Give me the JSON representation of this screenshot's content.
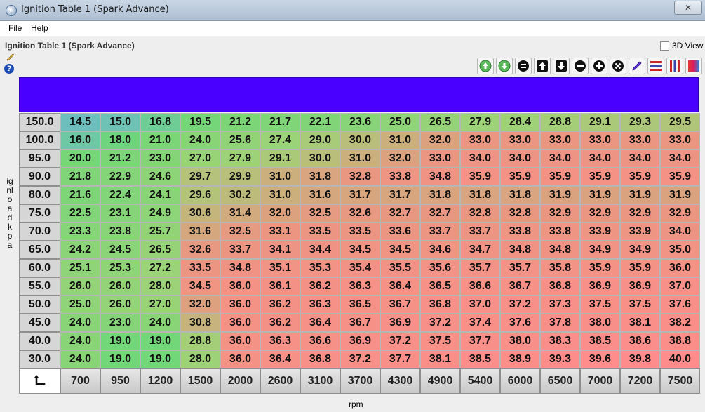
{
  "window": {
    "title": "Ignition Table 1 (Spark Advance)",
    "close": "✕"
  },
  "menu": {
    "file": "File",
    "help": "Help"
  },
  "panel": {
    "title": "Ignition Table 1 (Spark Advance)",
    "view3d_label": "3D View",
    "help_glyph": "?"
  },
  "toolbar": {
    "icons": [
      "increment-green-icon",
      "decrement-green-icon",
      "equal-icon",
      "arrow-up-icon",
      "arrow-down-icon",
      "minus-icon",
      "plus-icon",
      "multiply-icon",
      "pencil-icon",
      "horizontal-interpolate-icon",
      "vertical-interpolate-icon",
      "color-gradient-icon"
    ]
  },
  "colors": {
    "banner": "#4a00ff",
    "cool": "#5fd06e",
    "hot": "#ff9a8c"
  },
  "table": {
    "y_axis_title": "ignload kpa",
    "x_axis_title": "rpm",
    "corner_icon": "swap-axes-icon",
    "rpm": [
      "700",
      "950",
      "1200",
      "1500",
      "2000",
      "2600",
      "3100",
      "3700",
      "4300",
      "4900",
      "5400",
      "6000",
      "6500",
      "7000",
      "7200",
      "7500"
    ],
    "load": [
      "150.0",
      "100.0",
      "95.0",
      "90.0",
      "80.0",
      "75.0",
      "70.0",
      "65.0",
      "60.0",
      "55.0",
      "50.0",
      "45.0",
      "40.0",
      "30.0"
    ],
    "values": [
      [
        "14.5",
        "15.0",
        "16.8",
        "19.5",
        "21.2",
        "21.7",
        "22.1",
        "23.6",
        "25.0",
        "26.5",
        "27.9",
        "28.4",
        "28.8",
        "29.1",
        "29.3",
        "29.5"
      ],
      [
        "16.0",
        "18.0",
        "21.0",
        "24.0",
        "25.6",
        "27.4",
        "29.0",
        "30.0",
        "31.0",
        "32.0",
        "33.0",
        "33.0",
        "33.0",
        "33.0",
        "33.0",
        "33.0"
      ],
      [
        "20.0",
        "21.2",
        "23.0",
        "27.0",
        "27.9",
        "29.1",
        "30.0",
        "31.0",
        "32.0",
        "33.0",
        "34.0",
        "34.0",
        "34.0",
        "34.0",
        "34.0",
        "34.0"
      ],
      [
        "21.8",
        "22.9",
        "24.6",
        "29.7",
        "29.9",
        "31.0",
        "31.8",
        "32.8",
        "33.8",
        "34.8",
        "35.9",
        "35.9",
        "35.9",
        "35.9",
        "35.9",
        "35.9"
      ],
      [
        "21.6",
        "22.4",
        "24.1",
        "29.6",
        "30.2",
        "31.0",
        "31.6",
        "31.7",
        "31.7",
        "31.8",
        "31.8",
        "31.8",
        "31.9",
        "31.9",
        "31.9",
        "31.9"
      ],
      [
        "22.5",
        "23.1",
        "24.9",
        "30.6",
        "31.4",
        "32.0",
        "32.5",
        "32.6",
        "32.7",
        "32.7",
        "32.8",
        "32.8",
        "32.9",
        "32.9",
        "32.9",
        "32.9"
      ],
      [
        "23.3",
        "23.8",
        "25.7",
        "31.6",
        "32.5",
        "33.1",
        "33.5",
        "33.5",
        "33.6",
        "33.7",
        "33.7",
        "33.8",
        "33.8",
        "33.9",
        "33.9",
        "34.0"
      ],
      [
        "24.2",
        "24.5",
        "26.5",
        "32.6",
        "33.7",
        "34.1",
        "34.4",
        "34.5",
        "34.5",
        "34.6",
        "34.7",
        "34.8",
        "34.8",
        "34.9",
        "34.9",
        "35.0"
      ],
      [
        "25.1",
        "25.3",
        "27.2",
        "33.5",
        "34.8",
        "35.1",
        "35.3",
        "35.4",
        "35.5",
        "35.6",
        "35.7",
        "35.7",
        "35.8",
        "35.9",
        "35.9",
        "36.0"
      ],
      [
        "26.0",
        "26.0",
        "28.0",
        "34.5",
        "36.0",
        "36.1",
        "36.2",
        "36.3",
        "36.4",
        "36.5",
        "36.6",
        "36.7",
        "36.8",
        "36.9",
        "36.9",
        "37.0"
      ],
      [
        "25.0",
        "26.0",
        "27.0",
        "32.0",
        "36.0",
        "36.2",
        "36.3",
        "36.5",
        "36.7",
        "36.8",
        "37.0",
        "37.2",
        "37.3",
        "37.5",
        "37.5",
        "37.6"
      ],
      [
        "24.0",
        "23.0",
        "24.0",
        "30.8",
        "36.0",
        "36.2",
        "36.4",
        "36.7",
        "36.9",
        "37.2",
        "37.4",
        "37.6",
        "37.8",
        "38.0",
        "38.1",
        "38.2"
      ],
      [
        "24.0",
        "19.0",
        "19.0",
        "28.8",
        "36.0",
        "36.3",
        "36.6",
        "36.9",
        "37.2",
        "37.5",
        "37.7",
        "38.0",
        "38.3",
        "38.5",
        "38.6",
        "38.8"
      ],
      [
        "24.0",
        "19.0",
        "19.0",
        "28.0",
        "36.0",
        "36.4",
        "36.8",
        "37.2",
        "37.7",
        "38.1",
        "38.5",
        "38.9",
        "39.3",
        "39.6",
        "39.8",
        "40.0"
      ]
    ]
  }
}
